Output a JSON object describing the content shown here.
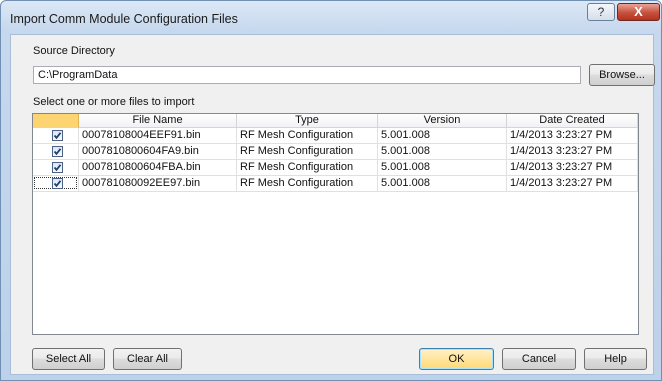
{
  "window": {
    "title": "Import Comm Module Configuration Files",
    "help_label": "?",
    "close_label": "X"
  },
  "source": {
    "label": "Source Directory",
    "path": "C:\\ProgramData",
    "browse_label": "Browse..."
  },
  "select_label": "Select one or more files to import",
  "table": {
    "columns": [
      "File Name",
      "Type",
      "Version",
      "Date Created"
    ],
    "rows": [
      {
        "checked": true,
        "file": "00078108004EEF91.bin",
        "type": "RF Mesh Configuration",
        "version": "5.001.008",
        "date": "1/4/2013 3:23:27 PM"
      },
      {
        "checked": true,
        "file": "0007810800604FA9.bin",
        "type": "RF Mesh Configuration",
        "version": "5.001.008",
        "date": "1/4/2013 3:23:27 PM"
      },
      {
        "checked": true,
        "file": "0007810800604FBA.bin",
        "type": "RF Mesh Configuration",
        "version": "5.001.008",
        "date": "1/4/2013 3:23:27 PM"
      },
      {
        "checked": true,
        "file": "000781080092EE97.bin",
        "type": "RF Mesh Configuration",
        "version": "5.001.008",
        "date": "1/4/2013 3:23:27 PM"
      }
    ]
  },
  "buttons": {
    "select_all": "Select All",
    "clear_all": "Clear All",
    "ok": "OK",
    "cancel": "Cancel",
    "help": "Help"
  }
}
